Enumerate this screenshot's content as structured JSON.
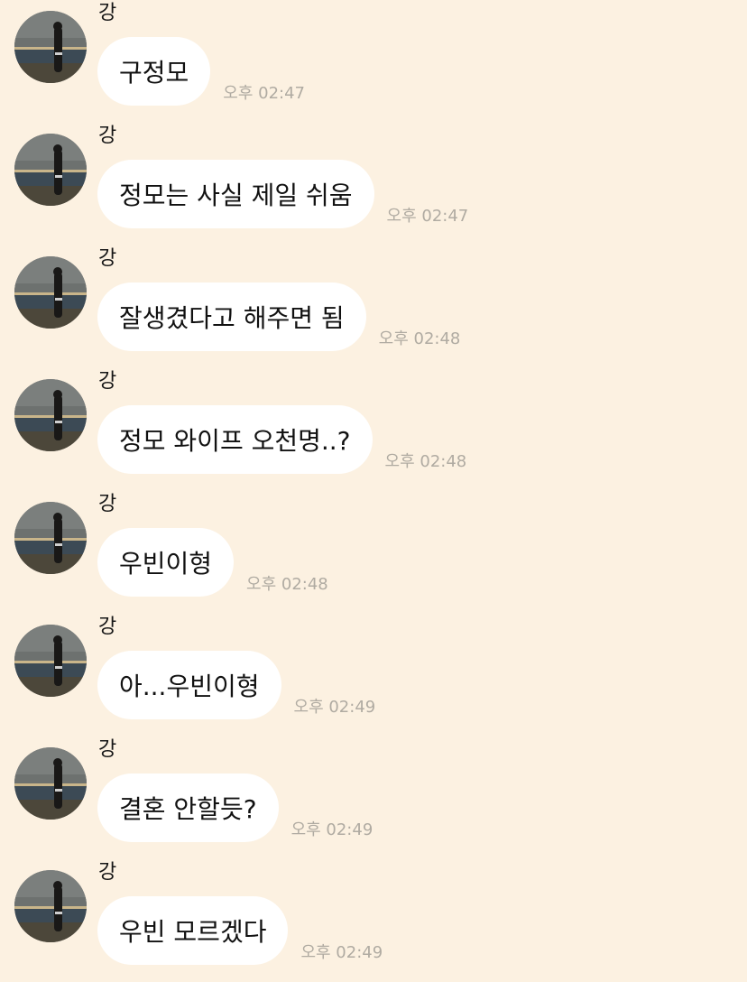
{
  "messages": [
    {
      "sender": "강",
      "text": "구정모",
      "time": "오후 02:47"
    },
    {
      "sender": "강",
      "text": "정모는 사실 제일 쉬움",
      "time": "오후 02:47"
    },
    {
      "sender": "강",
      "text": "잘생겼다고 해주면 됨",
      "time": "오후 02:48"
    },
    {
      "sender": "강",
      "text": "정모 와이프 오천명..?",
      "time": "오후 02:48"
    },
    {
      "sender": "강",
      "text": "우빈이형",
      "time": "오후 02:48"
    },
    {
      "sender": "강",
      "text": "아...우빈이형",
      "time": "오후 02:49"
    },
    {
      "sender": "강",
      "text": "결혼 안할듯?",
      "time": "오후 02:49"
    },
    {
      "sender": "강",
      "text": "우빈 모르겠다",
      "time": "오후 02:49"
    }
  ],
  "colors": {
    "background": "#fcf1e1",
    "bubble": "#ffffff",
    "time": "#b0aba2"
  },
  "icons": {
    "avatar": "profile-photo"
  }
}
